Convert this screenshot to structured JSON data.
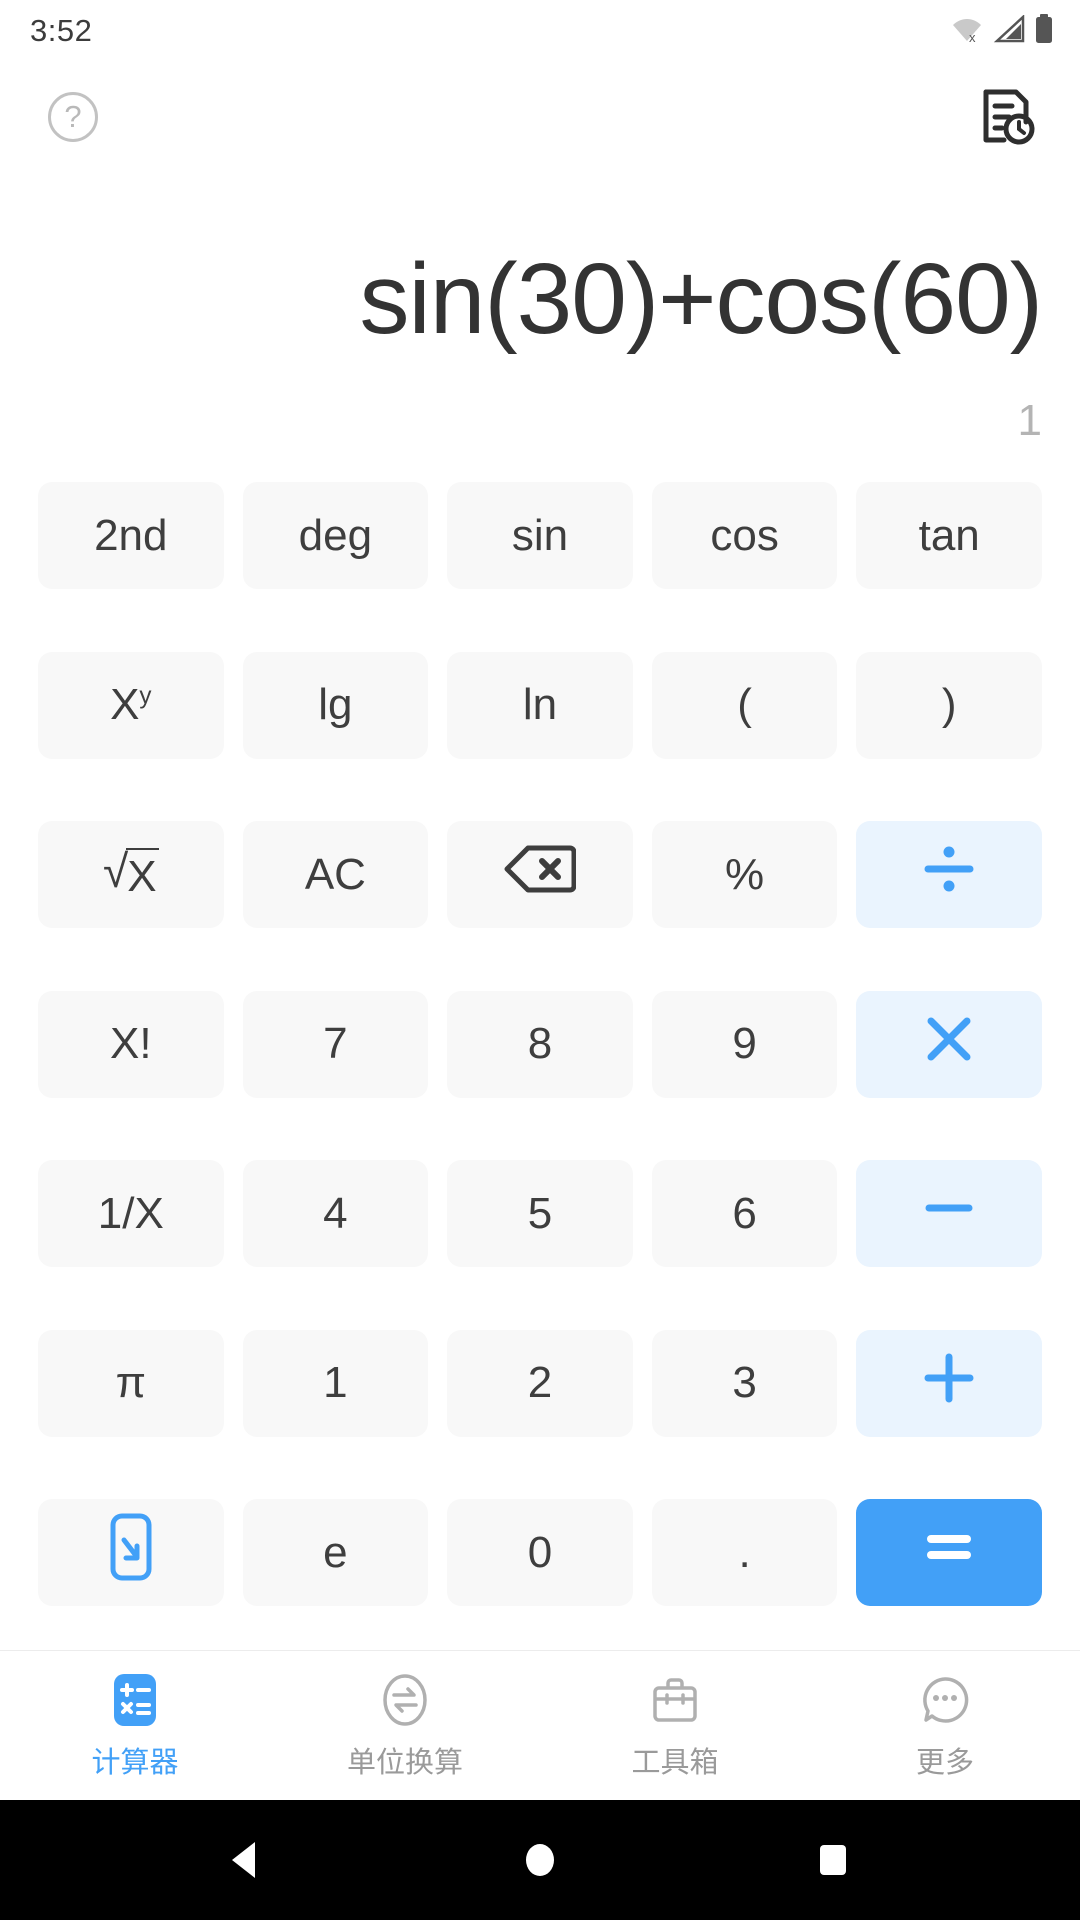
{
  "status_bar": {
    "time": "3:52",
    "icons": [
      "wifi-off-icon",
      "signal-icon",
      "battery-icon"
    ]
  },
  "top_actions": {
    "help_label": "?",
    "help_icon": "help-circle-icon",
    "history_icon": "history-document-icon"
  },
  "display": {
    "expression": "sin(30)+cos(60)",
    "result": "1"
  },
  "colors": {
    "accent": "#42a0f7",
    "operator_bg": "#eaf4fe",
    "key_bg": "#f8f8f8",
    "key_text": "#3e3e3e",
    "expression_text": "#333333",
    "result_text": "#b4b4b4",
    "nav_inactive": "#9a9a9a"
  },
  "keypad": {
    "rows": [
      [
        {
          "label": "2nd",
          "name": "key-second",
          "type": "fn"
        },
        {
          "label": "deg",
          "name": "key-deg",
          "type": "fn"
        },
        {
          "label": "sin",
          "name": "key-sin",
          "type": "fn"
        },
        {
          "label": "cos",
          "name": "key-cos",
          "type": "fn"
        },
        {
          "label": "tan",
          "name": "key-tan",
          "type": "fn"
        }
      ],
      [
        {
          "label": "X",
          "sup": "y",
          "name": "key-power",
          "type": "fn"
        },
        {
          "label": "lg",
          "name": "key-lg",
          "type": "fn"
        },
        {
          "label": "ln",
          "name": "key-ln",
          "type": "fn"
        },
        {
          "label": "(",
          "name": "key-left-paren",
          "type": "fn"
        },
        {
          "label": ")",
          "name": "key-right-paren",
          "type": "fn"
        }
      ],
      [
        {
          "label": "√X",
          "name": "key-sqrt",
          "type": "sqrt"
        },
        {
          "label": "AC",
          "name": "key-all-clear",
          "type": "fn"
        },
        {
          "label": "",
          "name": "key-backspace",
          "type": "icon",
          "icon": "backspace-icon"
        },
        {
          "label": "%",
          "name": "key-percent",
          "type": "fn"
        },
        {
          "label": "÷",
          "name": "key-divide",
          "type": "operator",
          "icon": "divide-icon"
        }
      ],
      [
        {
          "label": "X!",
          "name": "key-factorial",
          "type": "fn"
        },
        {
          "label": "7",
          "name": "key-7",
          "type": "digit"
        },
        {
          "label": "8",
          "name": "key-8",
          "type": "digit"
        },
        {
          "label": "9",
          "name": "key-9",
          "type": "digit"
        },
        {
          "label": "×",
          "name": "key-multiply",
          "type": "operator",
          "icon": "multiply-icon"
        }
      ],
      [
        {
          "label": "1/X",
          "name": "key-reciprocal",
          "type": "fn"
        },
        {
          "label": "4",
          "name": "key-4",
          "type": "digit"
        },
        {
          "label": "5",
          "name": "key-5",
          "type": "digit"
        },
        {
          "label": "6",
          "name": "key-6",
          "type": "digit"
        },
        {
          "label": "−",
          "name": "key-minus",
          "type": "operator",
          "icon": "minus-icon"
        }
      ],
      [
        {
          "label": "π",
          "name": "key-pi",
          "type": "fn"
        },
        {
          "label": "1",
          "name": "key-1",
          "type": "digit"
        },
        {
          "label": "2",
          "name": "key-2",
          "type": "digit"
        },
        {
          "label": "3",
          "name": "key-3",
          "type": "digit"
        },
        {
          "label": "+",
          "name": "key-plus",
          "type": "operator",
          "icon": "plus-icon"
        }
      ],
      [
        {
          "label": "",
          "name": "key-hide-keyboard",
          "type": "icon",
          "icon": "collapse-keyboard-icon"
        },
        {
          "label": "e",
          "name": "key-e",
          "type": "fn"
        },
        {
          "label": "0",
          "name": "key-0",
          "type": "digit"
        },
        {
          "label": ".",
          "name": "key-decimal",
          "type": "digit"
        },
        {
          "label": "=",
          "name": "key-equals",
          "type": "equals",
          "icon": "equals-icon"
        }
      ]
    ]
  },
  "bottom_nav": {
    "items": [
      {
        "label": "计算器",
        "icon": "calculator-icon",
        "name": "nav-calculator",
        "active": true
      },
      {
        "label": "单位换算",
        "icon": "unit-convert-icon",
        "name": "nav-unit-convert",
        "active": false
      },
      {
        "label": "工具箱",
        "icon": "toolbox-icon",
        "name": "nav-toolbox",
        "active": false
      },
      {
        "label": "更多",
        "icon": "more-bubble-icon",
        "name": "nav-more",
        "active": false
      }
    ]
  },
  "system_nav": {
    "back": "back-triangle-icon",
    "home": "home-circle-icon",
    "recents": "recents-square-icon"
  }
}
